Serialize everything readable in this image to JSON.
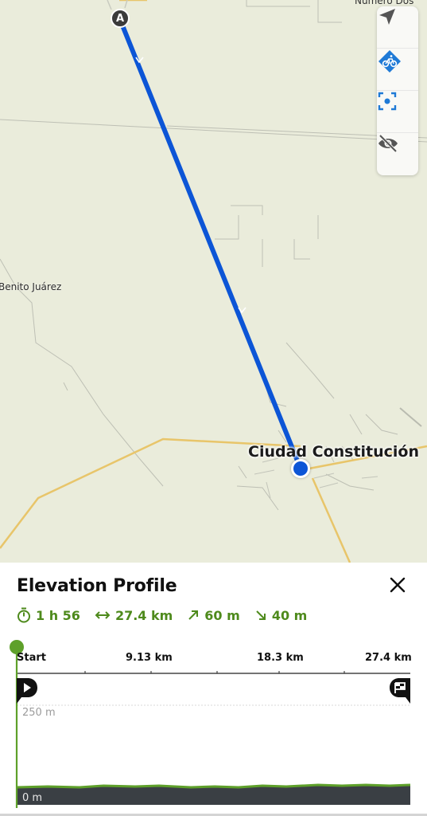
{
  "map": {
    "labels": {
      "city": "Ciudad Constitución",
      "town_left": "Benito Juárez",
      "town_topright": "Número Dos"
    },
    "start_marker": "A",
    "route_color": "#0c55d6"
  },
  "map_tools": [
    {
      "name": "navigate-icon"
    },
    {
      "name": "bicycle-profile-icon"
    },
    {
      "name": "focus-location-icon"
    },
    {
      "name": "visibility-off-icon"
    }
  ],
  "panel": {
    "title": "Elevation Profile",
    "close_icon": "close-icon",
    "stats": {
      "duration": "1 h 56",
      "distance": "27.4 km",
      "ascent": "60 m",
      "descent": "40 m"
    },
    "axis": {
      "start": "Start",
      "tick1": "9.13 km",
      "tick2": "18.3 km",
      "tick3": "27.4 km"
    },
    "elevation": {
      "max_label": "250 m",
      "min_label": "0 m"
    },
    "colors": {
      "accent": "#5ea02a",
      "profile_fill": "#3a3f44"
    }
  }
}
